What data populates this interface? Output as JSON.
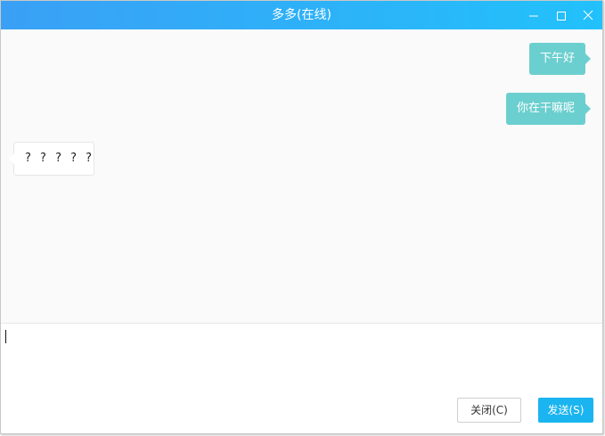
{
  "window": {
    "title": "多多(在线)",
    "accent_gradient": [
      "#3aa0f5",
      "#22c1fb"
    ]
  },
  "messages": [
    {
      "direction": "outgoing",
      "text": "下午好"
    },
    {
      "direction": "outgoing",
      "text": "你在干嘛呢"
    },
    {
      "direction": "incoming",
      "text": "? ? ? ? ?"
    }
  ],
  "colors": {
    "outgoing_bubble": "#6ccfcf",
    "send_button": "#1ab4f0"
  },
  "input": {
    "value": "",
    "placeholder": ""
  },
  "buttons": {
    "close_label": "关闭(C)",
    "send_label": "发送(S)"
  },
  "icons": {
    "minimize": "minimize-icon",
    "maximize": "maximize-icon",
    "close": "close-icon"
  }
}
